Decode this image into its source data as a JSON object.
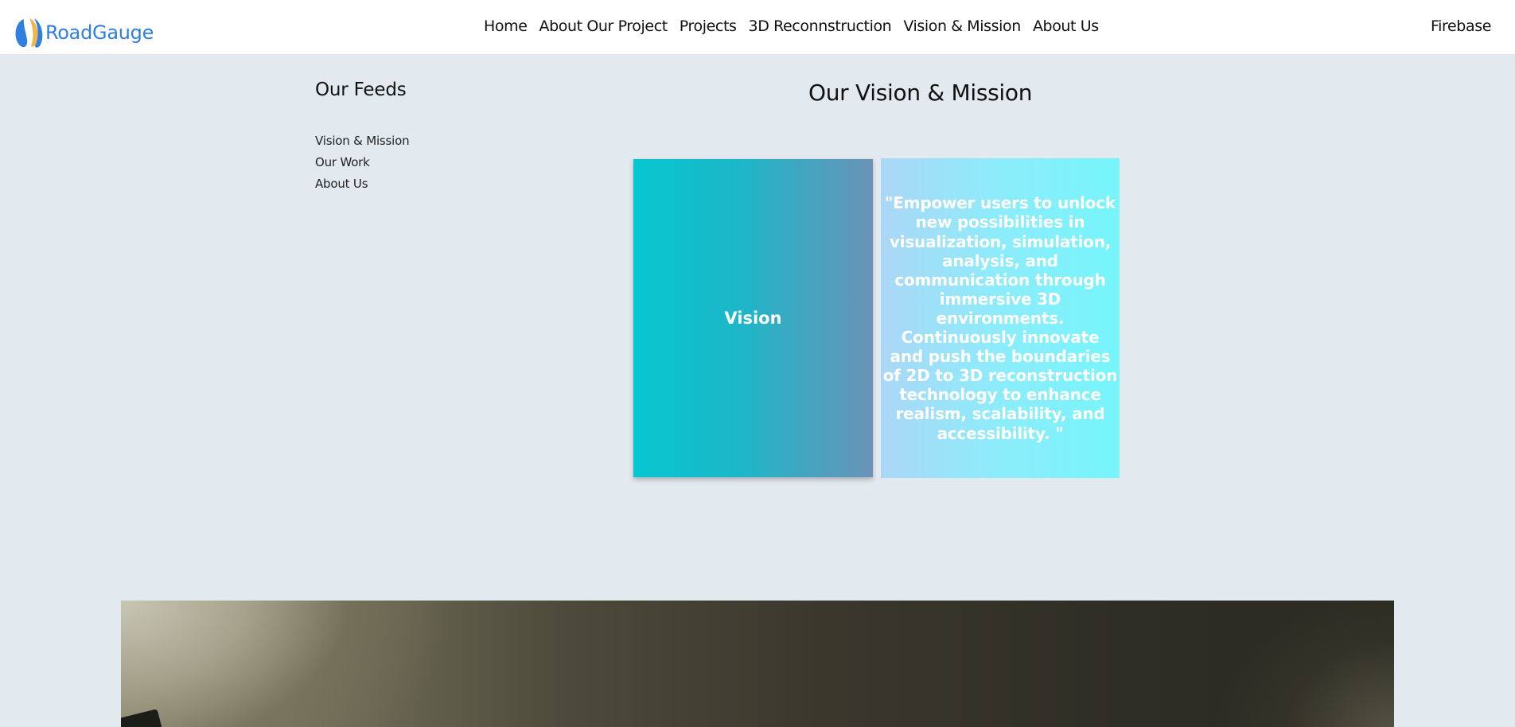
{
  "navbar": {
    "brand": "RoadGauge",
    "links": [
      {
        "label": "Home"
      },
      {
        "label": "About Our Project"
      },
      {
        "label": "Projects"
      },
      {
        "label": "3D Reconnstruction"
      },
      {
        "label": "Vision & Mission"
      },
      {
        "label": "About Us"
      }
    ],
    "right_link": "Firebase"
  },
  "sidebar": {
    "title": "Our Feeds",
    "items": [
      {
        "label": "Vision & Mission"
      },
      {
        "label": "Our Work"
      },
      {
        "label": "About Us"
      }
    ]
  },
  "main": {
    "title": "Our Vision & Mission",
    "card": {
      "front_label": "Vision",
      "back_text": "\"Empower users to unlock new possibilities in visualization, simulation, analysis, and communication through immersive 3D environments. Continuously innovate and push the boundaries of 2D to 3D reconstruction technology to enhance realism, scalability, and accessibility. \""
    }
  },
  "colors": {
    "page_background": "#e3eaef",
    "brand_blue": "#2f7fe0",
    "card_front_start": "#06c7cf",
    "card_front_end": "#6a92b6",
    "card_back_start": "#abd7f6",
    "card_back_end": "#76f5fb"
  }
}
